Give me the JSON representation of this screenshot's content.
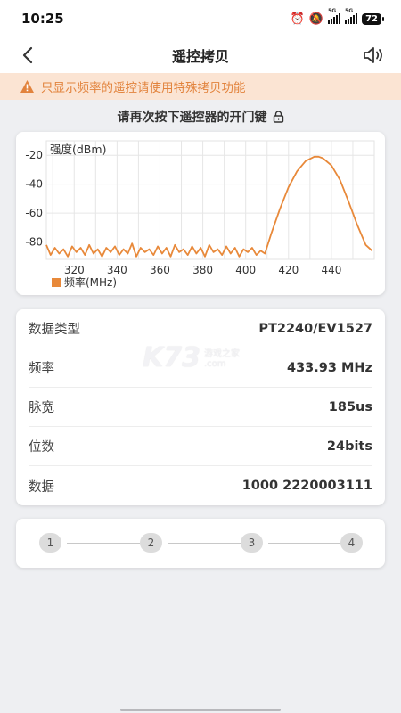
{
  "status_bar": {
    "time": "10:25",
    "net1": "5G",
    "net2": "5G",
    "battery": "72"
  },
  "header": {
    "title": "遥控拷贝",
    "back_icon": "chevron-left-icon",
    "speaker_icon": "speaker-icon"
  },
  "warning": {
    "text": "只显示频率的遥控请使用特殊拷贝功能",
    "icon": "warning-icon",
    "color": "#e2833d"
  },
  "prompt": {
    "text": "请再次按下遥控器的开门键",
    "icon": "lock-icon"
  },
  "chart_data": {
    "type": "line",
    "ylabel": "强度(dBm)",
    "legend": "频率(MHz)",
    "legend_position": "bottom-left",
    "x_ticks": [
      "320",
      "340",
      "360",
      "380",
      "400",
      "420",
      "440"
    ],
    "y_ticks": [
      "-20",
      "-40",
      "-60",
      "-80"
    ],
    "xlim": [
      307,
      460
    ],
    "ylim": [
      -92,
      -10
    ],
    "grid": true,
    "color": "#e8893a",
    "series": [
      {
        "x": [
          307,
          309,
          311,
          313,
          315,
          317,
          319,
          321,
          323,
          325,
          327,
          329,
          331,
          333,
          335,
          337,
          339,
          341,
          343,
          345,
          347,
          349,
          351,
          353,
          355,
          357,
          359,
          361,
          363,
          365,
          367,
          369,
          371,
          373,
          375,
          377,
          379,
          381,
          383,
          385,
          387,
          389,
          391,
          393,
          395,
          397,
          399,
          401,
          403,
          405,
          407,
          409,
          412,
          416,
          420,
          424,
          428,
          432,
          434,
          436,
          440,
          444,
          448,
          452,
          456,
          459
        ],
        "y": [
          -82,
          -89,
          -84,
          -88,
          -85,
          -90,
          -83,
          -87,
          -84,
          -89,
          -82,
          -88,
          -85,
          -90,
          -84,
          -87,
          -83,
          -89,
          -85,
          -88,
          -81,
          -90,
          -84,
          -87,
          -85,
          -89,
          -83,
          -88,
          -84,
          -90,
          -82,
          -87,
          -85,
          -89,
          -83,
          -88,
          -84,
          -90,
          -82,
          -87,
          -85,
          -89,
          -83,
          -88,
          -84,
          -90,
          -85,
          -87,
          -84,
          -89,
          -86,
          -88,
          -74,
          -57,
          -42,
          -31,
          -24,
          -21,
          -21,
          -22,
          -27,
          -37,
          -52,
          -68,
          -82,
          -86
        ]
      }
    ]
  },
  "info": {
    "rows": [
      {
        "label": "数据类型",
        "value": "PT2240/EV1527"
      },
      {
        "label": "频率",
        "value": "433.93 MHz"
      },
      {
        "label": "脉宽",
        "value": "185us"
      },
      {
        "label": "位数",
        "value": "24bits"
      },
      {
        "label": "数据",
        "value": "1000 2220003111"
      }
    ]
  },
  "steps": [
    "1",
    "2",
    "3",
    "4"
  ],
  "watermark": {
    "logo": "K73",
    "line1": "游戏之家",
    "line2": ".com"
  }
}
